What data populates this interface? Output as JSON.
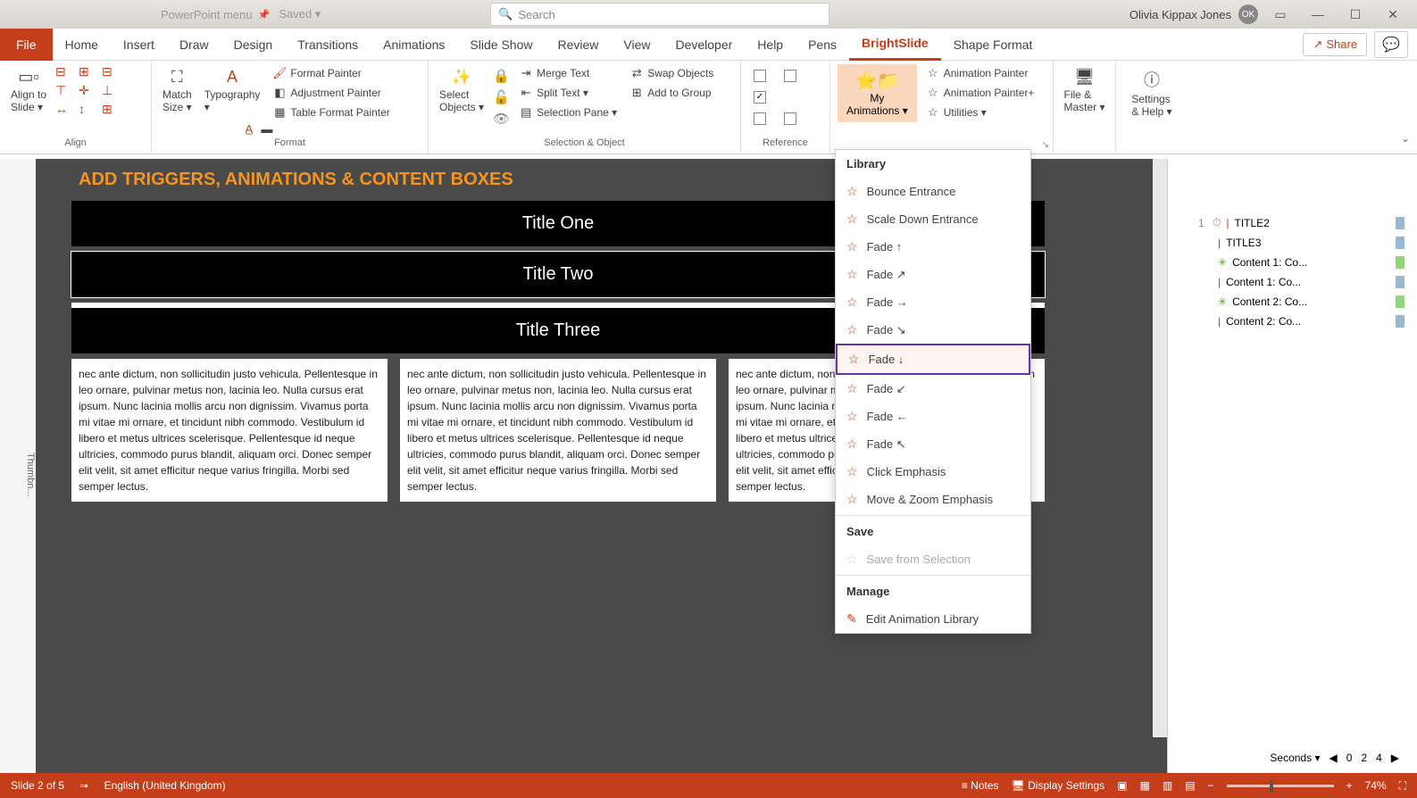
{
  "titlebar": {
    "docname": "PowerPoint  menu",
    "saved": "Saved ▾",
    "search_ph": "Search",
    "user": "Olivia Kippax Jones",
    "initials": "OK"
  },
  "tabs": {
    "file": "File",
    "items": [
      "Home",
      "Insert",
      "Draw",
      "Design",
      "Transitions",
      "Animations",
      "Slide Show",
      "Review",
      "View",
      "Developer",
      "Help",
      "Pens",
      "BrightSlide",
      "Shape Format"
    ],
    "share": "Share"
  },
  "ribbon": {
    "alignment": {
      "label": "Align",
      "btn": "Align to\nSlide ▾"
    },
    "format": {
      "label": "Format",
      "match": "Match\nSize ▾",
      "typo": "Typography\n▾",
      "fp": "Format Painter",
      "ap": "Adjustment Painter",
      "tfp": "Table Format Painter"
    },
    "sel": {
      "label": "Selection & Object",
      "select": "Select\nObjects ▾",
      "merge": "Merge Text",
      "swap": "Swap Objects",
      "split": "Split Text ▾",
      "addg": "Add to Group",
      "selp": "Selection Pane ▾"
    },
    "ref": {
      "label": "Reference"
    },
    "anim": {
      "myanim": "My\nAnimations ▾",
      "ap1": "Animation Painter",
      "ap2": "Animation Painter+",
      "util": "Utilities ▾"
    },
    "fm": {
      "btn": "File &\nMaster ▾"
    },
    "sh": {
      "btn": "Settings\n& Help ▾"
    }
  },
  "dropdown": {
    "h1": "Library",
    "items": [
      "Bounce Entrance",
      "Scale Down Entrance",
      "Fade ↑",
      "Fade ↗",
      "Fade →",
      "Fade ↘",
      "Fade ↓",
      "Fade ↙",
      "Fade ←",
      "Fade ↖",
      "Click Emphasis",
      "Move & Zoom Emphasis"
    ],
    "h2": "Save",
    "save": "Save from Selection",
    "h3": "Manage",
    "edit": "Edit Animation Library"
  },
  "slide": {
    "heading": "ADD TRIGGERS, ANIMATIONS & CONTENT BOXES",
    "t1": "Title One",
    "t2": "Title Two",
    "t3": "Title Three",
    "content": "nec ante dictum, non sollicitudin justo vehicula. Pellentesque in leo ornare, pulvinar metus non, lacinia leo. Nulla cursus erat ipsum. Nunc lacinia mollis arcu non dignissim. Vivamus porta mi vitae mi ornare, et tincidunt nibh commodo. Vestibulum id libero et metus ultrices scelerisque. Pellentesque id neque ultricies, commodo purus blandit, aliquam orci. Donec semper elit velit, sit amet efficitur neque varius fringilla. Morbi sed semper lectus."
  },
  "animpane": {
    "rows": [
      {
        "n": "1",
        "icon": "⏱",
        "sub": "|",
        "label": "TITLE2",
        "color": "#9bb8d3"
      },
      {
        "n": "",
        "icon": "",
        "sub": "|",
        "label": "TITLE3",
        "color": "#9bb8d3"
      },
      {
        "n": "",
        "icon": "",
        "sub": "✳",
        "label": "Content 1: Co...",
        "color": "#8fd67a"
      },
      {
        "n": "",
        "icon": "",
        "sub": "|",
        "label": "Content 1: Co...",
        "color": "#9bb8d3"
      },
      {
        "n": "",
        "icon": "",
        "sub": "✳",
        "label": "Content 2: Co...",
        "color": "#8fd67a"
      },
      {
        "n": "",
        "icon": "",
        "sub": "|",
        "label": "Content 2: Co...",
        "color": "#9bb8d3"
      }
    ],
    "seconds": "Seconds ▾",
    "axis": [
      "0",
      "2",
      "4"
    ]
  },
  "status": {
    "slide": "Slide 2 of 5",
    "lang": "English (United Kingdom)",
    "notes": "Notes",
    "disp": "Display Settings",
    "zoom": "74%"
  }
}
